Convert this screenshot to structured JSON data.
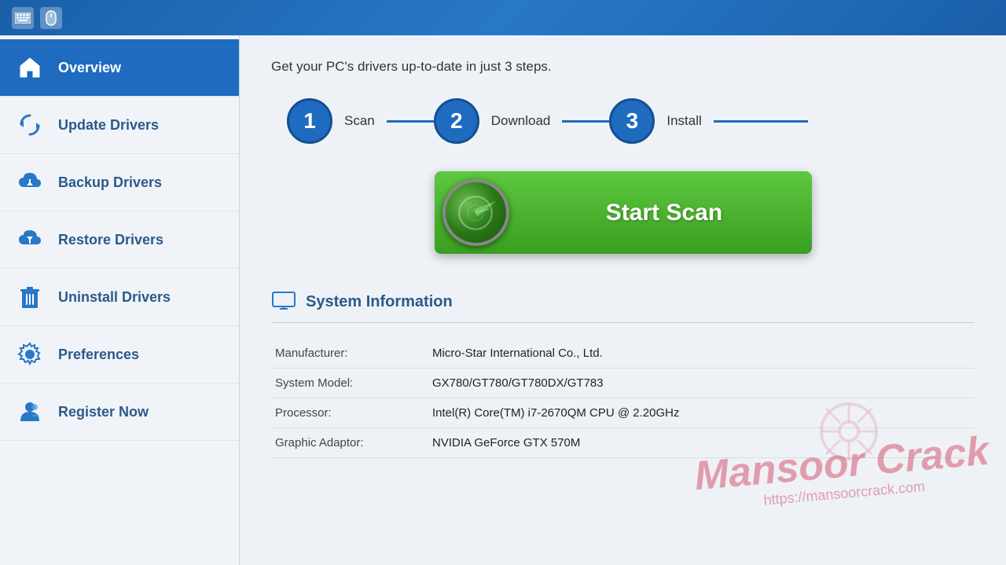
{
  "titlebar": {
    "icons": [
      "keyboard-icon",
      "mouse-icon"
    ]
  },
  "sidebar": {
    "items": [
      {
        "id": "overview",
        "label": "Overview",
        "icon": "home-icon",
        "active": true
      },
      {
        "id": "update-drivers",
        "label": "Update Drivers",
        "icon": "update-icon",
        "active": false
      },
      {
        "id": "backup-drivers",
        "label": "Backup Drivers",
        "icon": "backup-icon",
        "active": false
      },
      {
        "id": "restore-drivers",
        "label": "Restore Drivers",
        "icon": "restore-icon",
        "active": false
      },
      {
        "id": "uninstall-drivers",
        "label": "Uninstall Drivers",
        "icon": "trash-icon",
        "active": false
      },
      {
        "id": "preferences",
        "label": "Preferences",
        "icon": "gear-icon",
        "active": false
      },
      {
        "id": "register",
        "label": "Register Now",
        "icon": "person-icon",
        "active": false
      }
    ]
  },
  "main": {
    "tagline": "Get your PC's drivers up-to-date in just 3 steps.",
    "steps": [
      {
        "number": "1",
        "label": "Scan"
      },
      {
        "number": "2",
        "label": "Download"
      },
      {
        "number": "3",
        "label": "Install"
      }
    ],
    "scan_button_label": "Start Scan",
    "system_info": {
      "title": "System Information",
      "rows": [
        {
          "label": "Manufacturer:",
          "value": "Micro-Star International Co., Ltd."
        },
        {
          "label": "System Model:",
          "value": "GX780/GT780/GT780DX/GT783"
        },
        {
          "label": "Processor:",
          "value": "Intel(R) Core(TM) i7-2670QM CPU @ 2.20GHz"
        },
        {
          "label": "Graphic Adaptor:",
          "value": "NVIDIA GeForce GTX 570M"
        }
      ]
    }
  },
  "watermark": {
    "brand": "Mansoor",
    "brand2": "Crack",
    "url": "https://mansoorcrack.com"
  }
}
